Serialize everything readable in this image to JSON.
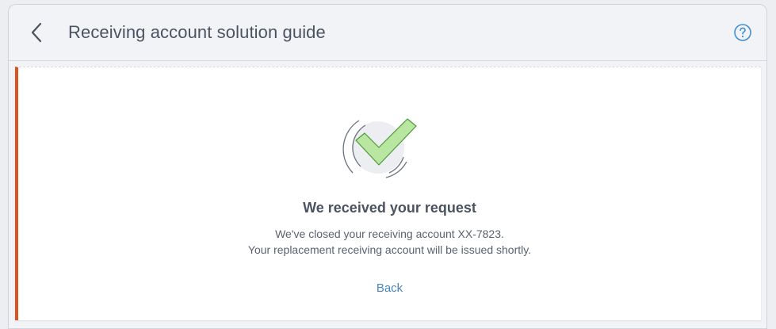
{
  "header": {
    "title": "Receiving account solution guide",
    "back_icon": "chevron-left-icon",
    "help_icon": "question-circle-icon"
  },
  "confirmation": {
    "icon": "checkmark-success-icon",
    "heading": "We received your request",
    "line1": "We've closed your receiving account XX-7823.",
    "line2": "Your replacement receiving account will be issued shortly.",
    "back_label": "Back"
  },
  "colors": {
    "accent_bar": "#d9541e",
    "link": "#4a86b8",
    "check_fill": "#b9e6a0",
    "check_stroke": "#4c9a3a",
    "help_icon": "#3d8fd1"
  }
}
